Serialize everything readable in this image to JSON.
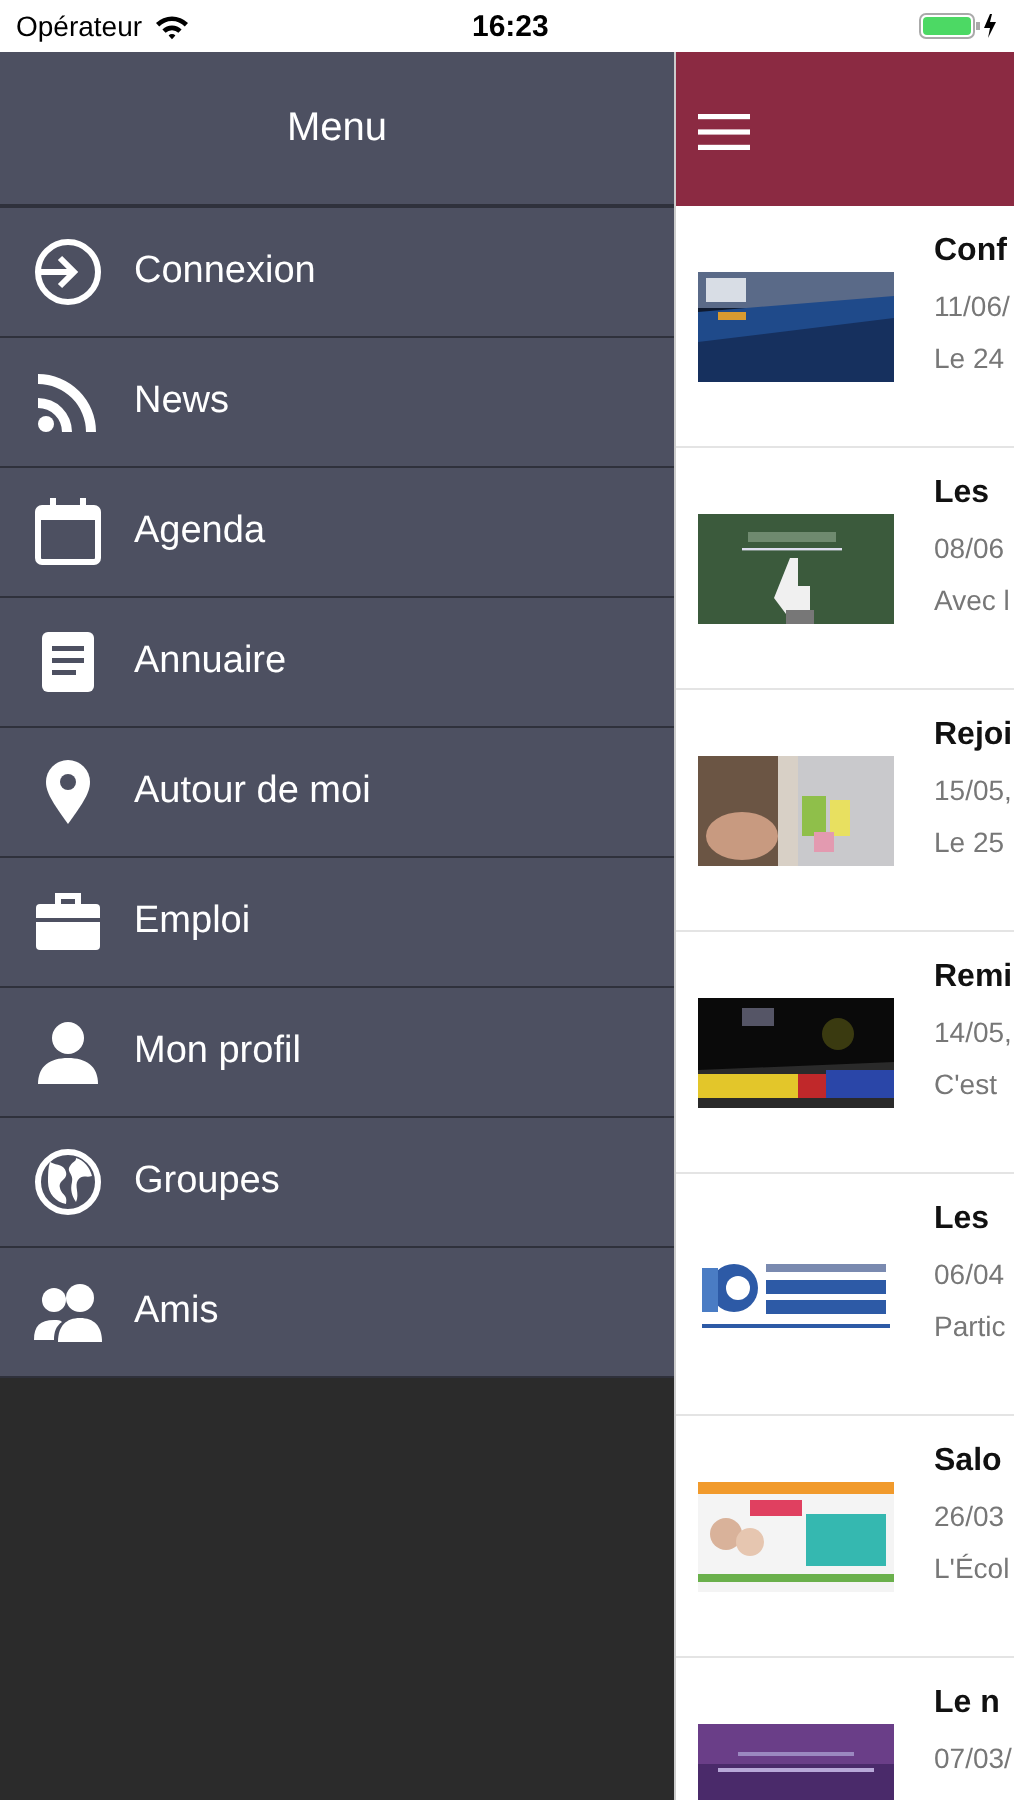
{
  "status_bar": {
    "carrier": "Opérateur",
    "time": "16:23"
  },
  "menu": {
    "title": "Menu",
    "items": [
      {
        "label": "Connexion"
      },
      {
        "label": "News"
      },
      {
        "label": "Agenda"
      },
      {
        "label": "Annuaire"
      },
      {
        "label": "Autour de moi"
      },
      {
        "label": "Emploi"
      },
      {
        "label": "Mon profil"
      },
      {
        "label": "Groupes"
      },
      {
        "label": "Amis"
      }
    ]
  },
  "news": {
    "items": [
      {
        "title": "Conf",
        "date": "11/06/",
        "excerpt": "Le 24"
      },
      {
        "title": "Les",
        "date": "08/06",
        "excerpt": "Avec l"
      },
      {
        "title": "Rejoi",
        "date": "15/05,",
        "excerpt": "Le 25"
      },
      {
        "title": "Remi",
        "date": "14/05,",
        "excerpt": "C'est"
      },
      {
        "title": "Les",
        "date": "06/04",
        "excerpt": "Partic"
      },
      {
        "title": "Salo",
        "date": "26/03",
        "excerpt": "L'Écol"
      },
      {
        "title": "Le n",
        "date": "07/03/"
      }
    ]
  }
}
